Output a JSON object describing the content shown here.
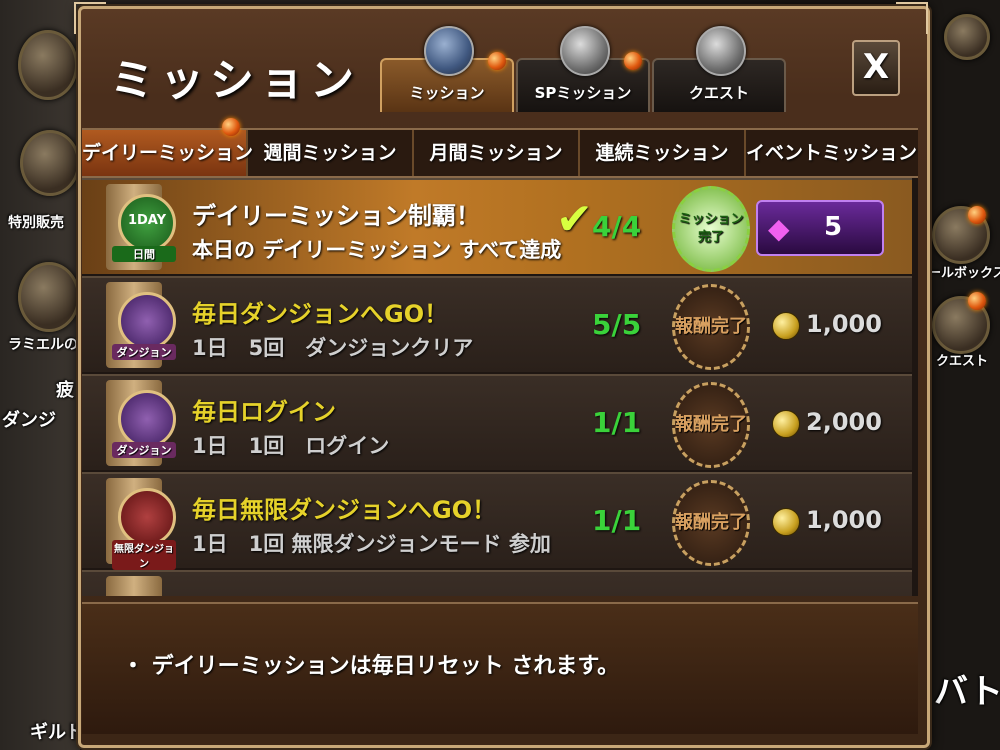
{
  "panel": {
    "title": "ミッション",
    "close_label": "X"
  },
  "main_tabs": [
    {
      "label": "ミッション",
      "active": true
    },
    {
      "label": "SPミッション",
      "active": false
    },
    {
      "label": "クエスト",
      "active": false
    }
  ],
  "sub_tabs": [
    {
      "label": "デイリーミッション",
      "active": true
    },
    {
      "label": "週間ミッション",
      "active": false
    },
    {
      "label": "月間ミッション",
      "active": false
    },
    {
      "label": "連続ミッション",
      "active": false
    },
    {
      "label": "イベントミッション",
      "active": false
    }
  ],
  "missions": [
    {
      "badge": "日間",
      "badge_top": "1DAY",
      "title": "デイリーミッション制覇！",
      "desc": "本日の デイリーミッション すべて達成",
      "progress": "4/4",
      "stamp": "ミッション完了",
      "reward": "5",
      "reward_type": "gem",
      "highlight": true
    },
    {
      "badge": "ダンジョン",
      "title": "毎日ダンジョンへGO！",
      "desc": "1日　5回　ダンジョンクリア",
      "progress": "5/5",
      "stamp": "報酬完了",
      "reward": "1,000",
      "reward_type": "coin"
    },
    {
      "badge": "ダンジョン",
      "title": "毎日ログイン",
      "desc": "1日　1回　ログイン",
      "progress": "1/1",
      "stamp": "報酬完了",
      "reward": "2,000",
      "reward_type": "coin"
    },
    {
      "badge": "無限ダンジョン",
      "title": "毎日無限ダンジョンへGO！",
      "desc": "1日　1回 無限ダンジョンモード 参加",
      "progress": "1/1",
      "stamp": "報酬完了",
      "reward": "1,000",
      "reward_type": "coin"
    }
  ],
  "footer_note": "・ デイリーミッションは毎日リセット されます。",
  "side_left": [
    "特別販売",
    "ラミエルの秘",
    "疲",
    "ダンジ",
    "ギルド"
  ],
  "side_right": [
    "ールボックス",
    "クエスト",
    "バトル"
  ],
  "colors": {
    "accent": "#e6d22a",
    "progress": "#3ad23a",
    "highlight": "#c07a28"
  }
}
